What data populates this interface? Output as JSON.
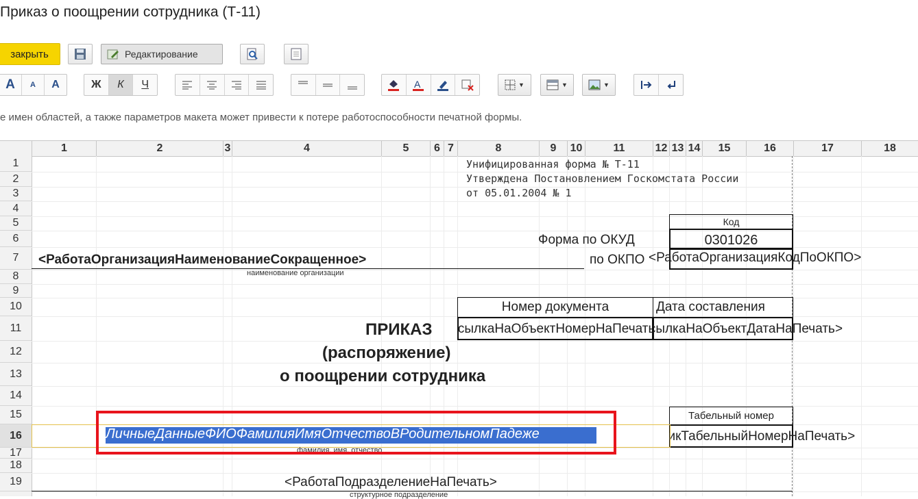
{
  "window": {
    "title": "Приказ о поощрении сотрудника (Т-11)"
  },
  "toolbar": {
    "close_label": "закрыть",
    "editing_label": "Редактирование",
    "bold_label": "Ж",
    "italic_label": "К",
    "underline_label": "Ч",
    "font_larger": "A",
    "font_smaller": "A",
    "font_grow": "A"
  },
  "warning_text": "е имен областей, а также параметров макета может привести к потере работоспособности печатной формы.",
  "grid": {
    "columns": [
      "1",
      "2",
      "3",
      "4",
      "5",
      "6",
      "7",
      "8",
      "9",
      "10",
      "11",
      "12",
      "13",
      "14",
      "15",
      "16",
      "17",
      "18"
    ],
    "rows": [
      "1",
      "2",
      "3",
      "4",
      "5",
      "6",
      "7",
      "8",
      "9",
      "10",
      "11",
      "12",
      "13",
      "14",
      "15",
      "16",
      "17",
      "18",
      "19"
    ],
    "active_row": "16"
  },
  "doc": {
    "unified_form": "Унифицированная форма № Т-11",
    "approved": "Утверждена Постановлением Госкомстата России",
    "date_line": "от 05.01.2004 № 1",
    "kod": "Код",
    "okud_label": "Форма по ОКУД",
    "okud_value": "0301026",
    "okpo_label": "по ОКПО",
    "okpo_param": "<РаботаОрганизацияКодПоОКПО>",
    "org_param": "<РаботаОрганизацияНаименованиеСокращенное>",
    "org_caption": "наименование организации",
    "doc_number_label": "Номер документа",
    "doc_date_label": "Дата составления",
    "doc_number_param": "<СсылкаНаОбъектНомерНаПечать>",
    "doc_date_param": "<СсылкаНаОбъектДатаНаПечать>",
    "heading1": "ПРИКАЗ",
    "heading2": "(распоряжение)",
    "heading3": "о поощрении сотрудника",
    "tab_number_label": "Табельный номер",
    "tab_number_param": "<СотрудникТабельныйНомерНаПечать>",
    "fio_param": "ЛичныеДанныеФИОФамилияИмяОтчествоВРодительномПадеже",
    "fio_caption": "фамилия, имя, отчество",
    "dept_param": "<РаботаПодразделениеНаПечать>",
    "dept_caption": "структурное подразделение"
  },
  "colors": {
    "highlight_frame": "#e8141c",
    "selection": "#3a6ecf",
    "close_button": "#f6d400"
  }
}
